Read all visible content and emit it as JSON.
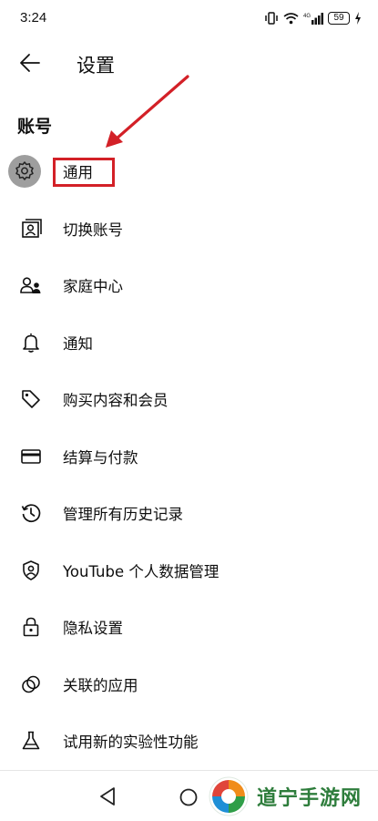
{
  "status_bar": {
    "time": "3:24",
    "signal_label": "4G",
    "battery": "59"
  },
  "header": {
    "title": "设置"
  },
  "section": {
    "title": "账号"
  },
  "items": [
    {
      "label": "通用",
      "icon": "gear-icon"
    },
    {
      "label": "切换账号",
      "icon": "switch-account-icon"
    },
    {
      "label": "家庭中心",
      "icon": "family-center-icon"
    },
    {
      "label": "通知",
      "icon": "bell-icon"
    },
    {
      "label": "购买内容和会员",
      "icon": "tag-icon"
    },
    {
      "label": "结算与付款",
      "icon": "credit-card-icon"
    },
    {
      "label": "管理所有历史记录",
      "icon": "history-icon"
    },
    {
      "label": "YouTube 个人数据管理",
      "icon": "shield-person-icon"
    },
    {
      "label": "隐私设置",
      "icon": "lock-icon"
    },
    {
      "label": "关联的应用",
      "icon": "linked-apps-icon"
    },
    {
      "label": "试用新的实验性功能",
      "icon": "flask-icon"
    }
  ],
  "annotation": {
    "highlight_color": "#d32027"
  },
  "watermark": {
    "text": "道宁手游网"
  }
}
